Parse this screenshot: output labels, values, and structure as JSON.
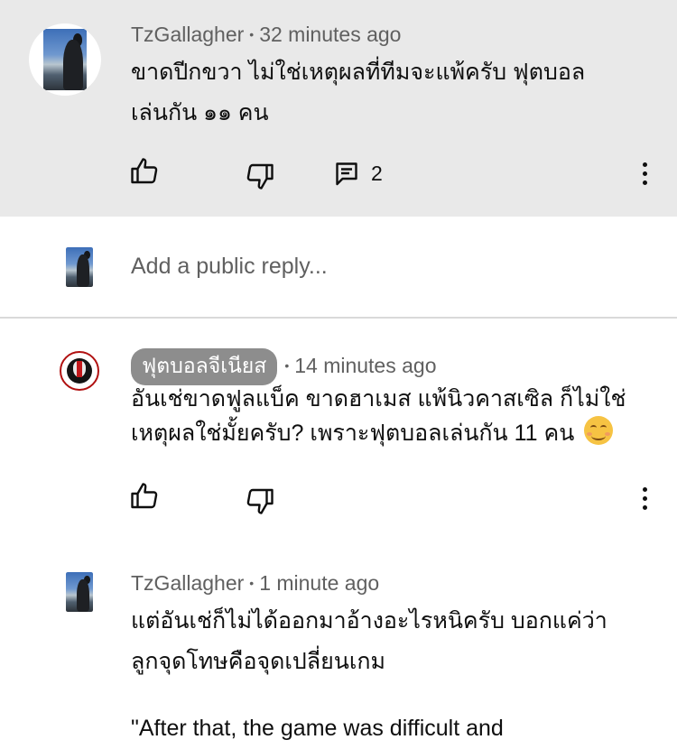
{
  "comments": [
    {
      "author": "TzGallagher",
      "time": "32 minutes ago",
      "text_line1": "ขาดปีกขวา ไม่ใช่เหตุผลที่ทีมจะแพ้ครับ ฟุตบอล",
      "text_line2": "เล่นกัน ๑๑ คน",
      "reply_count": "2"
    },
    {
      "author": "ฟุตบอลจีเนียส",
      "time": "14 minutes ago",
      "text_line1": "อันเช่ขาดฟูลแบ็ค ขาดฮาเมส แพ้นิวคาสเซิล ก็ไม่ใช่",
      "text_line2": "เหตุผลใช่มั้ยครับ? เพราะฟุตบอลเล่นกัน 11 คน"
    },
    {
      "author": "TzGallagher",
      "time": "1 minute ago",
      "text_line1": "แต่อันเช่ก็ไม่ได้ออกมาอ้างอะไรหนิครับ บอกแค่ว่า",
      "text_line2": "ลูกจุดโทษคือจุดเปลี่ยนเกม",
      "text_line3": "\"After that, the game was difficult and"
    }
  ],
  "reply_box": {
    "placeholder": "Add a public reply..."
  },
  "separator": "•",
  "icons": {
    "like": "thumbs-up-icon",
    "dislike": "thumbs-down-icon",
    "replies": "comment-icon",
    "more": "more-vertical-icon",
    "emoji": "smiling-face-emoji"
  },
  "colors": {
    "highlight_bg": "#e9e9e9",
    "meta_text": "#606060",
    "badge_bg": "#8d8d8d"
  }
}
